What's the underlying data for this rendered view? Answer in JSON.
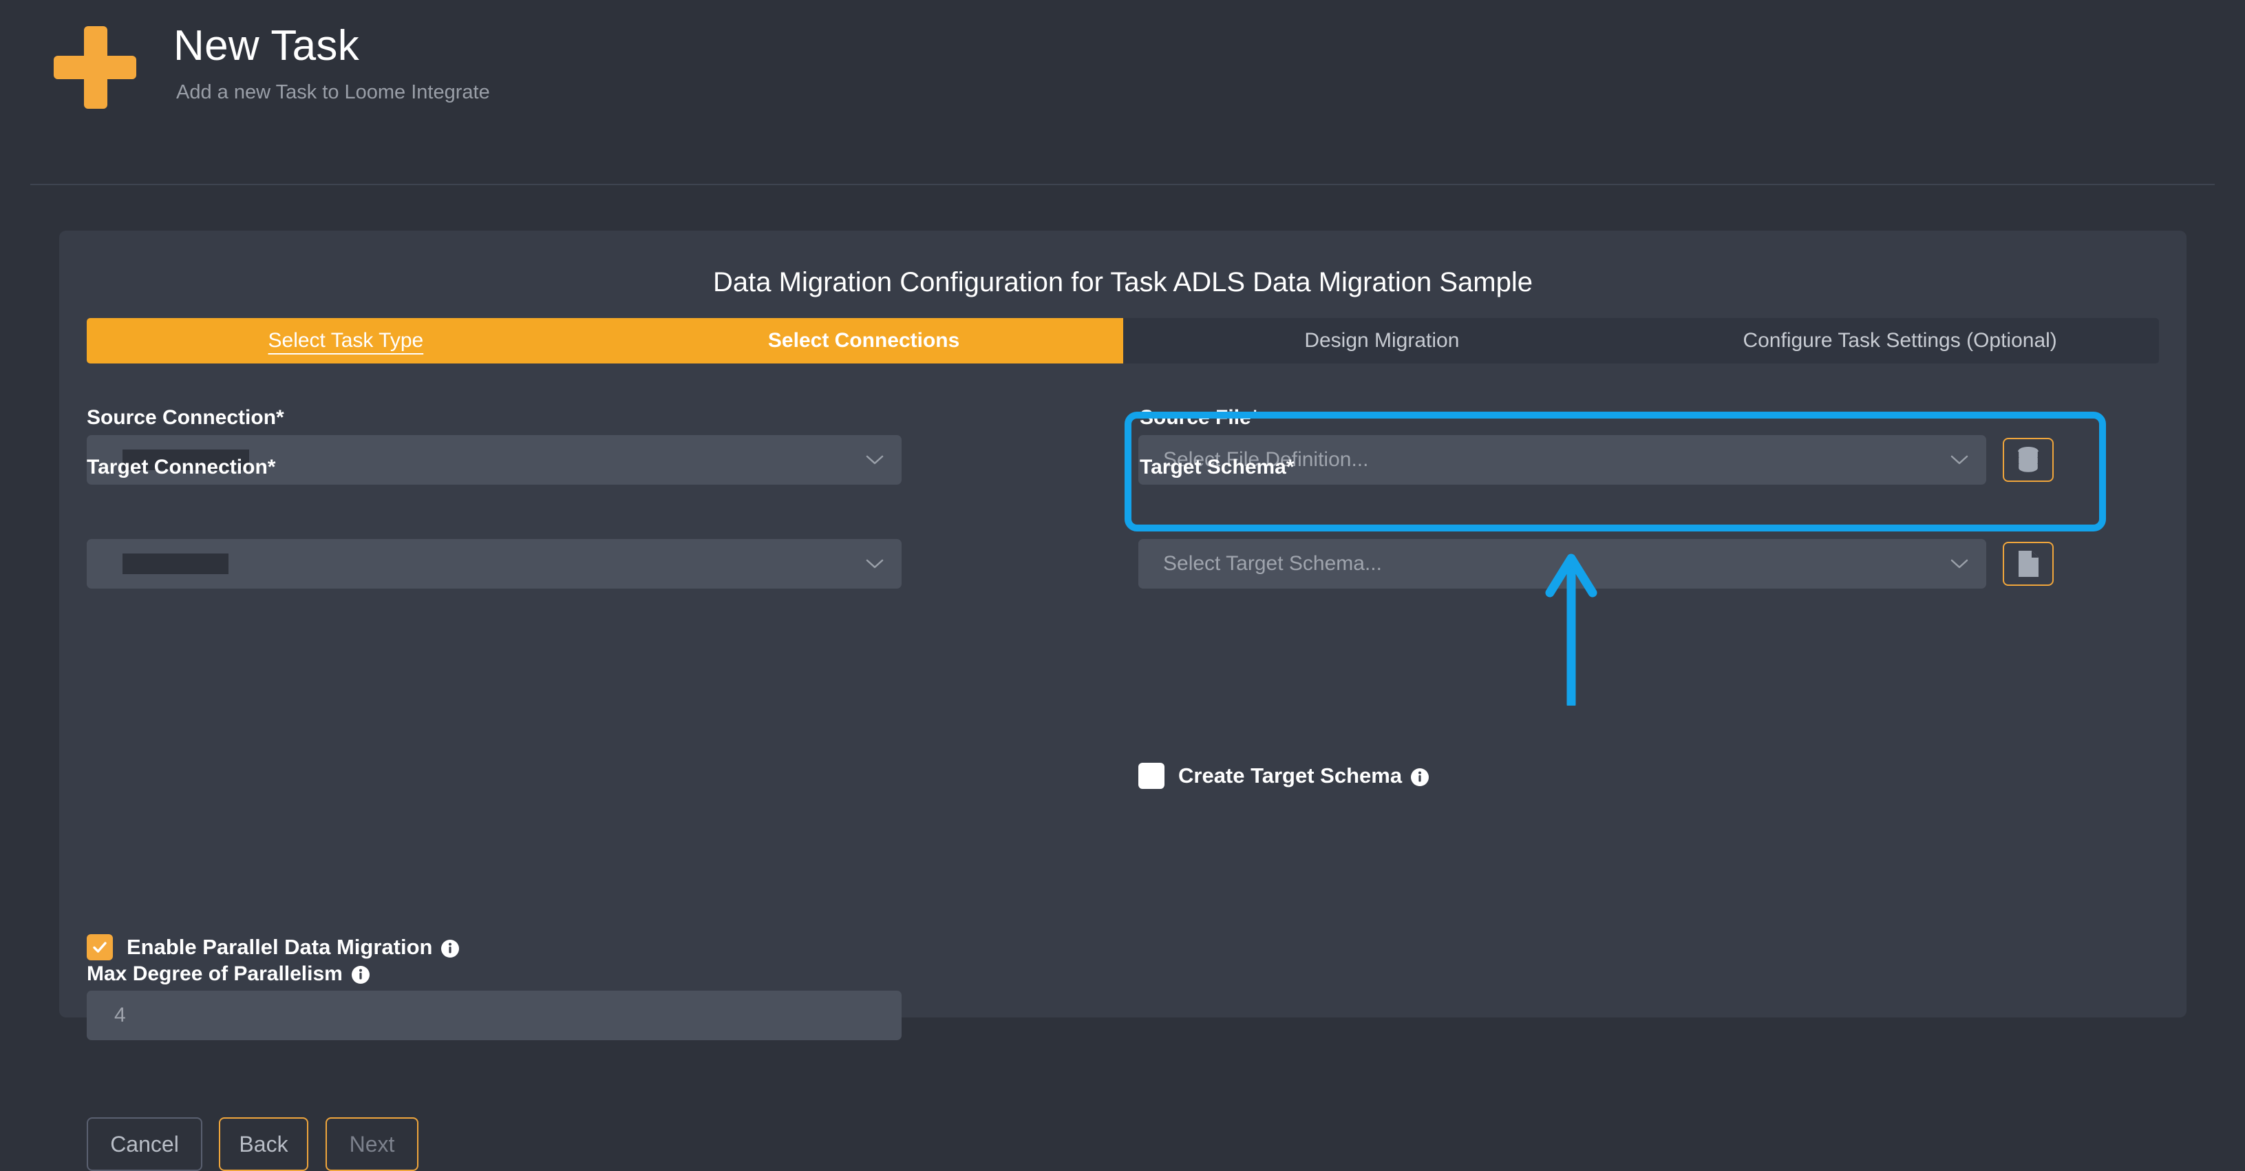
{
  "header": {
    "icon": "plus-icon",
    "title": "New Task",
    "subtitle": "Add a new Task to Loome Integrate"
  },
  "card": {
    "title": "Data Migration Configuration for Task ADLS Data Migration Sample",
    "tabs": [
      {
        "label": "Select Task Type",
        "state": "current"
      },
      {
        "label": "Select Connections",
        "state": "active"
      },
      {
        "label": "Design Migration",
        "state": "inactive"
      },
      {
        "label": "Configure Task Settings (Optional)",
        "state": "inactive"
      }
    ]
  },
  "form": {
    "source_connection": {
      "label": "Source Connection*",
      "value": "",
      "redacted": true
    },
    "target_connection": {
      "label": "Target Connection*",
      "value": "",
      "redacted": true
    },
    "source_file": {
      "label": "Source File*",
      "placeholder": "Select File Definition...",
      "value": "",
      "button_icon": "database-icon"
    },
    "target_schema": {
      "label": "Target Schema*",
      "placeholder": "Select Target Schema...",
      "value": "",
      "button_icon": "file-icon"
    },
    "create_target_schema": {
      "label": "Create Target Schema",
      "checked": false,
      "info_icon": "info-icon"
    },
    "enable_parallel": {
      "label": "Enable Parallel Data Migration",
      "checked": true,
      "info_icon": "info-icon"
    },
    "max_parallelism": {
      "label": "Max Degree of Parallelism",
      "placeholder": "4",
      "value": "",
      "info_icon": "info-icon"
    }
  },
  "actions": {
    "cancel": "Cancel",
    "back": "Back",
    "next": "Next"
  },
  "colors": {
    "accent_orange": "#f5a825",
    "annotation_blue": "#13a3eb",
    "page_background": "#2e323b",
    "card_background": "#383d48",
    "field_background": "#4b515d"
  }
}
